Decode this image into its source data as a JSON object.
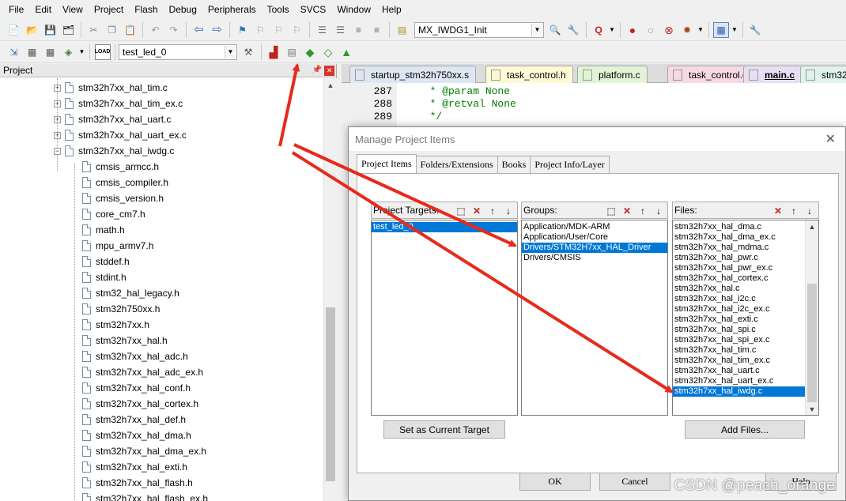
{
  "menubar": [
    "File",
    "Edit",
    "View",
    "Project",
    "Flash",
    "Debug",
    "Peripherals",
    "Tools",
    "SVCS",
    "Window",
    "Help"
  ],
  "toolbar": {
    "function_combo": "MX_IWDG1_Init",
    "target_combo": "test_led_0",
    "icons_row1": [
      "new-file-icon",
      "open-folder-icon",
      "save-icon",
      "save-all-icon",
      "cut-icon",
      "copy-icon",
      "paste-icon",
      "undo-icon",
      "redo-icon",
      "nav-back-icon",
      "nav-forward-icon",
      "bookmark-icon",
      "bookmark-prev-icon",
      "bookmark-next-icon",
      "bookmark-clear-icon",
      "indent-icon",
      "unindent-icon",
      "comment-icon",
      "uncomment-icon"
    ],
    "icons_row2": [
      "translate-icon",
      "build-icon",
      "rebuild-icon",
      "batch-build-icon",
      "download-icon",
      "target-options-icon",
      "manage-components-icon",
      "manage-rte-icon",
      "pack-installer-icon",
      "select-packs-icon"
    ],
    "colors": {
      "accent": "#0078d7",
      "highlight": "#dc2f23"
    }
  },
  "project_panel": {
    "title": "Project",
    "pin_icon": "pin-icon",
    "close_icon": "close-icon",
    "tree": [
      {
        "label": "stm32h7xx_hal_tim.c",
        "expander": "+"
      },
      {
        "label": "stm32h7xx_hal_tim_ex.c",
        "expander": "+"
      },
      {
        "label": "stm32h7xx_hal_uart.c",
        "expander": "+"
      },
      {
        "label": "stm32h7xx_hal_uart_ex.c",
        "expander": "+"
      },
      {
        "label": "stm32h7xx_hal_iwdg.c",
        "expander": "−"
      },
      {
        "label": "cmsis_armcc.h",
        "expander": ""
      },
      {
        "label": "cmsis_compiler.h",
        "expander": ""
      },
      {
        "label": "cmsis_version.h",
        "expander": ""
      },
      {
        "label": "core_cm7.h",
        "expander": ""
      },
      {
        "label": "math.h",
        "expander": ""
      },
      {
        "label": "mpu_armv7.h",
        "expander": ""
      },
      {
        "label": "stddef.h",
        "expander": ""
      },
      {
        "label": "stdint.h",
        "expander": ""
      },
      {
        "label": "stm32_hal_legacy.h",
        "expander": ""
      },
      {
        "label": "stm32h750xx.h",
        "expander": ""
      },
      {
        "label": "stm32h7xx.h",
        "expander": ""
      },
      {
        "label": "stm32h7xx_hal.h",
        "expander": ""
      },
      {
        "label": "stm32h7xx_hal_adc.h",
        "expander": ""
      },
      {
        "label": "stm32h7xx_hal_adc_ex.h",
        "expander": ""
      },
      {
        "label": "stm32h7xx_hal_conf.h",
        "expander": ""
      },
      {
        "label": "stm32h7xx_hal_cortex.h",
        "expander": ""
      },
      {
        "label": "stm32h7xx_hal_def.h",
        "expander": ""
      },
      {
        "label": "stm32h7xx_hal_dma.h",
        "expander": ""
      },
      {
        "label": "stm32h7xx_hal_dma_ex.h",
        "expander": ""
      },
      {
        "label": "stm32h7xx_hal_exti.h",
        "expander": ""
      },
      {
        "label": "stm32h7xx_hal_flash.h",
        "expander": ""
      },
      {
        "label": "stm32h7xx_hal_flash_ex.h",
        "expander": ""
      }
    ]
  },
  "editor": {
    "tabs": [
      {
        "label": "startup_stm32h750xx.s",
        "color": "#dde6f3",
        "active": false
      },
      {
        "label": "task_control.h",
        "color": "#fff9d6",
        "active": false
      },
      {
        "label": "platform.c",
        "color": "#e2f4d6",
        "active": false
      },
      {
        "label": "task_control.c",
        "color": "#f7d9e3",
        "active": false
      },
      {
        "label": "main.c",
        "color": "#e8dff5",
        "active": true
      },
      {
        "label": "stm32",
        "color": "#dff2ec",
        "active": false
      }
    ],
    "lines": [
      {
        "num": "287",
        "code": "  * @param None"
      },
      {
        "num": "288",
        "code": "  * @retval None"
      },
      {
        "num": "289",
        "code": "  */"
      }
    ]
  },
  "dialog": {
    "title": "Manage Project Items",
    "close_icon": "close-icon",
    "tabs": [
      "Project Items",
      "Folders/Extensions",
      "Books",
      "Project Info/Layer"
    ],
    "targets": {
      "label": "Project Targets:",
      "items": [
        "test_led_0"
      ],
      "selected": 0
    },
    "groups": {
      "label": "Groups:",
      "items": [
        "Application/MDK-ARM",
        "Application/User/Core",
        "Drivers/STM32H7xx_HAL_Driver",
        "Drivers/CMSIS"
      ],
      "selected": 2
    },
    "files": {
      "label": "Files:",
      "items": [
        "stm32h7xx_hal_dma.c",
        "stm32h7xx_hal_dma_ex.c",
        "stm32h7xx_hal_mdma.c",
        "stm32h7xx_hal_pwr.c",
        "stm32h7xx_hal_pwr_ex.c",
        "stm32h7xx_hal_cortex.c",
        "stm32h7xx_hal.c",
        "stm32h7xx_hal_i2c.c",
        "stm32h7xx_hal_i2c_ex.c",
        "stm32h7xx_hal_exti.c",
        "stm32h7xx_hal_spi.c",
        "stm32h7xx_hal_spi_ex.c",
        "stm32h7xx_hal_tim.c",
        "stm32h7xx_hal_tim_ex.c",
        "stm32h7xx_hal_uart.c",
        "stm32h7xx_hal_uart_ex.c",
        "stm32h7xx_hal_iwdg.c"
      ],
      "selected": 16
    },
    "set_target_label": "Set as Current Target",
    "add_files_label": "Add Files...",
    "ok_label": "OK",
    "cancel_label": "Cancel",
    "help_label": "Help"
  },
  "watermark": "CSDN @peach_orange"
}
